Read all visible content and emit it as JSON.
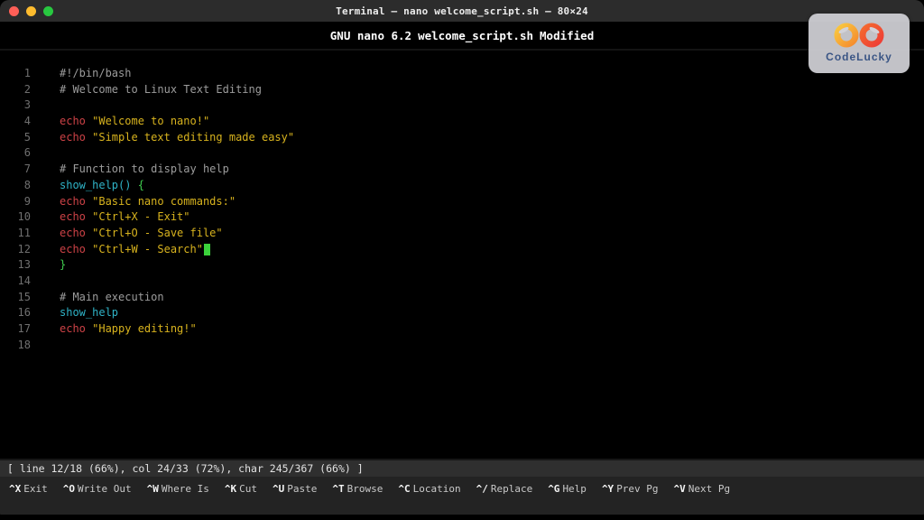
{
  "window": {
    "title": "Terminal — nano welcome_script.sh — 80×24",
    "traffic_lights": [
      {
        "name": "close",
        "color": "#ff5f57"
      },
      {
        "name": "minimize",
        "color": "#febc2e"
      },
      {
        "name": "zoom",
        "color": "#28c840"
      }
    ]
  },
  "nano_header": {
    "version": "GNU nano 6.2",
    "filename": "welcome_script.sh",
    "state": "Modified"
  },
  "colors": {
    "comment": "#9c9c9c",
    "command": "#cd4246",
    "string": "#d8b31e",
    "function": "#2fb3c7",
    "brace": "#3fcc4e",
    "plain": "#bfbfbf",
    "cursor": "#3bd23b",
    "line_number": "#6f6f6f"
  },
  "editor": {
    "lines": [
      {
        "n": 1,
        "segments": [
          {
            "t": "#!/bin/bash",
            "c": "comment"
          }
        ]
      },
      {
        "n": 2,
        "segments": [
          {
            "t": "# Welcome to Linux Text Editing",
            "c": "comment"
          }
        ]
      },
      {
        "n": 3,
        "segments": []
      },
      {
        "n": 4,
        "segments": [
          {
            "t": "echo ",
            "c": "command"
          },
          {
            "t": "\"Welcome to nano!\"",
            "c": "string"
          }
        ]
      },
      {
        "n": 5,
        "segments": [
          {
            "t": "echo ",
            "c": "command"
          },
          {
            "t": "\"Simple text editing made easy\"",
            "c": "string"
          }
        ]
      },
      {
        "n": 6,
        "segments": []
      },
      {
        "n": 7,
        "segments": [
          {
            "t": "# Function to display help",
            "c": "comment"
          }
        ]
      },
      {
        "n": 8,
        "segments": [
          {
            "t": "show_help()",
            "c": "function"
          },
          {
            "t": " ",
            "c": "plain"
          },
          {
            "t": "{",
            "c": "brace"
          }
        ]
      },
      {
        "n": 9,
        "segments": [
          {
            "t": "echo ",
            "c": "command"
          },
          {
            "t": "\"Basic nano commands:\"",
            "c": "string"
          }
        ]
      },
      {
        "n": 10,
        "segments": [
          {
            "t": "echo ",
            "c": "command"
          },
          {
            "t": "\"Ctrl+X - Exit\"",
            "c": "string"
          }
        ]
      },
      {
        "n": 11,
        "segments": [
          {
            "t": "echo ",
            "c": "command"
          },
          {
            "t": "\"Ctrl+O - Save file\"",
            "c": "string"
          }
        ]
      },
      {
        "n": 12,
        "segments": [
          {
            "t": "echo ",
            "c": "command"
          },
          {
            "t": "\"Ctrl+W - Search\"",
            "c": "string"
          },
          {
            "t": "",
            "c": "cursor"
          }
        ]
      },
      {
        "n": 13,
        "segments": [
          {
            "t": "}",
            "c": "brace"
          }
        ]
      },
      {
        "n": 14,
        "segments": []
      },
      {
        "n": 15,
        "segments": [
          {
            "t": "# Main execution",
            "c": "comment"
          }
        ]
      },
      {
        "n": 16,
        "segments": [
          {
            "t": "show_help",
            "c": "function"
          }
        ]
      },
      {
        "n": 17,
        "segments": [
          {
            "t": "echo ",
            "c": "command"
          },
          {
            "t": "\"Happy editing!\"",
            "c": "string"
          }
        ]
      },
      {
        "n": 18,
        "segments": []
      }
    ]
  },
  "status_bar": {
    "text": "[ line 12/18 (66%), col 24/33 (72%), char 245/367 (66%) ]"
  },
  "shortcuts": [
    {
      "key": "^X",
      "label": "Exit"
    },
    {
      "key": "^O",
      "label": "Write Out"
    },
    {
      "key": "^W",
      "label": "Where Is"
    },
    {
      "key": "^K",
      "label": "Cut"
    },
    {
      "key": "^U",
      "label": "Paste"
    },
    {
      "key": "^T",
      "label": "Browse"
    },
    {
      "key": "^C",
      "label": "Location"
    },
    {
      "key": "^/",
      "label": "Replace"
    },
    {
      "key": "^G",
      "label": "Help"
    },
    {
      "key": "^Y",
      "label": "Prev Pg"
    },
    {
      "key": "^V",
      "label": "Next Pg"
    }
  ],
  "badge": {
    "brand": "CodeLucky"
  }
}
